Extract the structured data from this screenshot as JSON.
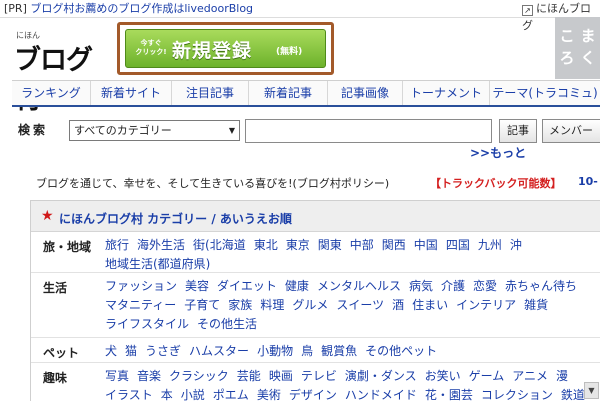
{
  "pr_bar": {
    "tag": "[PR]",
    "text": "ブログ村お薦めのブログ作成はlivedoorBlog",
    "right_text": "にほんブログ"
  },
  "logo": {
    "small": "にほん",
    "big": "ブログ村"
  },
  "register": {
    "pre_line1": "今すぐ",
    "pre_line2": "クリック!",
    "main": "新規登録",
    "free": "(無料)"
  },
  "corner_logo": {
    "chars": [
      "こ",
      "ま",
      "ろ",
      "く"
    ]
  },
  "tabs": [
    "ランキング",
    "新着サイト",
    "注目記事",
    "新着記事",
    "記事画像",
    "トーナメント",
    "テーマ(トラコミュ)"
  ],
  "search": {
    "label": "検索",
    "category_value": "すべてのカテゴリー",
    "query": "",
    "button_article": "記事",
    "button_member": "メンバー",
    "more_link": ">>もっと"
  },
  "policy_text": "ブログを通じて、幸せを、そして生きている喜びを!(ブログ村ポリシー)",
  "trackback_text": "【トラックバック可能数】",
  "trackback_count": "10-",
  "panel": {
    "title": "にほんブログ村 カテゴリー / あいうえお順",
    "rows": [
      {
        "label": "旅・地域",
        "links": [
          "旅行",
          "海外生活",
          "街(北海道",
          "東北",
          "東京",
          "関東",
          "中部",
          "関西",
          "中国",
          "四国",
          "九州",
          "沖",
          "地域生活(都道府県)"
        ]
      },
      {
        "label": "生活",
        "links": [
          "ファッション",
          "美容",
          "ダイエット",
          "健康",
          "メンタルヘルス",
          "病気",
          "介護",
          "恋愛",
          "赤ちゃん待ち",
          "マタニティー",
          "子育て",
          "家族",
          "料理",
          "グルメ",
          "スイーツ",
          "酒",
          "住まい",
          "インテリア",
          "雑貨",
          "ライフスタイル",
          "その他生活"
        ]
      },
      {
        "label": "ペット",
        "links": [
          "犬",
          "猫",
          "うさぎ",
          "ハムスター",
          "小動物",
          "鳥",
          "観賞魚",
          "その他ペット"
        ]
      },
      {
        "label": "趣味",
        "links": [
          "写真",
          "音楽",
          "クラシック",
          "芸能",
          "映画",
          "テレビ",
          "演劇・ダンス",
          "お笑い",
          "ゲーム",
          "アニメ",
          "漫",
          "イラスト",
          "本",
          "小説",
          "ポエム",
          "美術",
          "デザイン",
          "ハンドメイド",
          "花・園芸",
          "コレクション",
          "鉄道"
        ]
      }
    ]
  }
}
